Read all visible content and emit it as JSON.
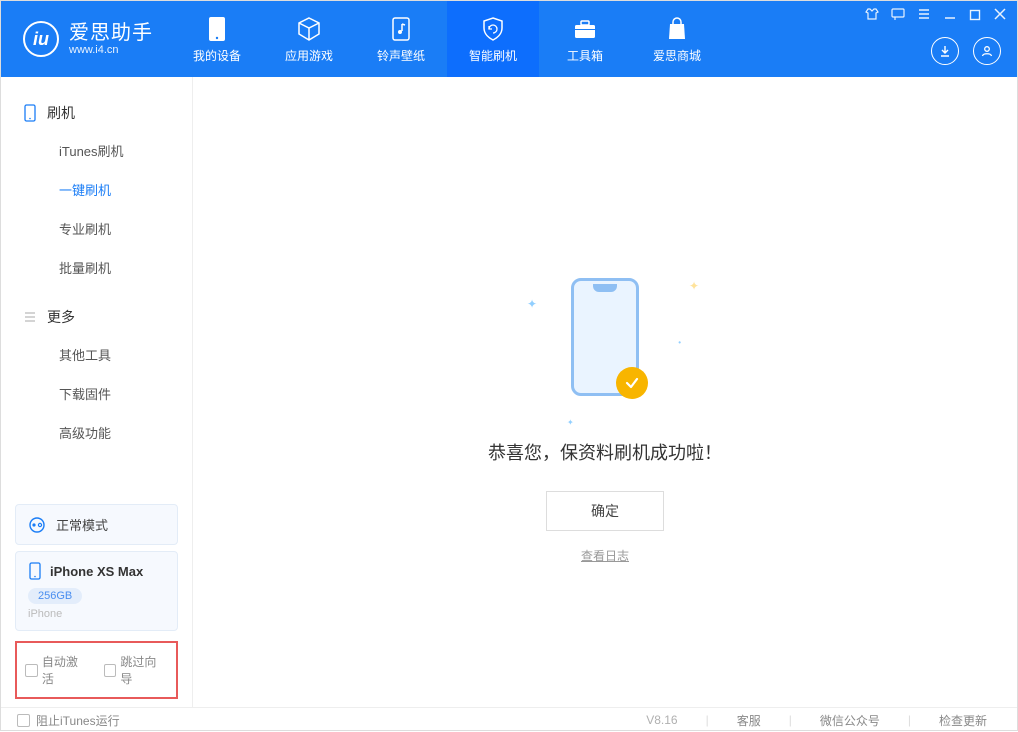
{
  "logo": {
    "title": "爱思助手",
    "sub": "www.i4.cn"
  },
  "nav": [
    {
      "id": "device",
      "label": "我的设备"
    },
    {
      "id": "apps",
      "label": "应用游戏"
    },
    {
      "id": "ring",
      "label": "铃声壁纸"
    },
    {
      "id": "flash",
      "label": "智能刷机"
    },
    {
      "id": "tools",
      "label": "工具箱"
    },
    {
      "id": "store",
      "label": "爱思商城"
    }
  ],
  "sidebar": {
    "group1": "刷机",
    "items1": [
      "iTunes刷机",
      "一键刷机",
      "专业刷机",
      "批量刷机"
    ],
    "group2": "更多",
    "items2": [
      "其他工具",
      "下载固件",
      "高级功能"
    ]
  },
  "device": {
    "mode": "正常模式",
    "name": "iPhone XS Max",
    "storage": "256GB",
    "type": "iPhone"
  },
  "checks": {
    "auto_activate": "自动激活",
    "skip_guide": "跳过向导"
  },
  "main": {
    "message": "恭喜您，保资料刷机成功啦！",
    "ok": "确定",
    "log": "查看日志"
  },
  "footer": {
    "block_itunes": "阻止iTunes运行",
    "version": "V8.16",
    "support": "客服",
    "wechat": "微信公众号",
    "update": "检查更新"
  }
}
